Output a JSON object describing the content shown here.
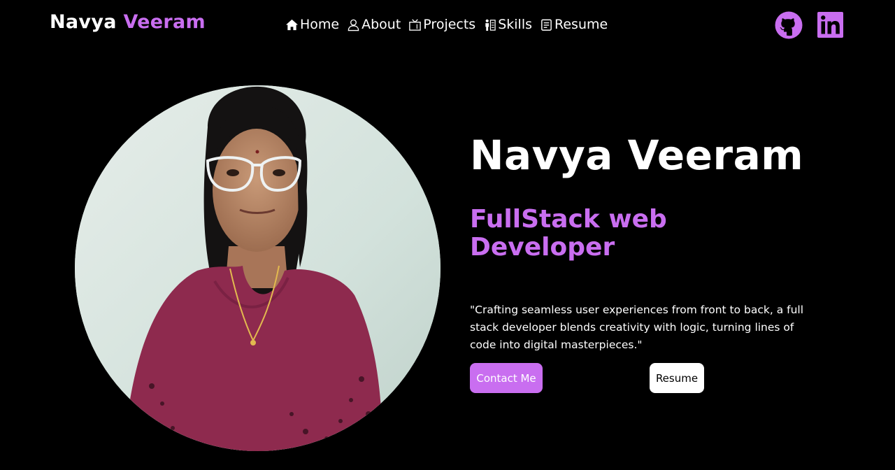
{
  "header": {
    "brand_first": "Navya",
    "brand_last": "Veeram",
    "nav": [
      {
        "label": "Home",
        "icon": "home-icon"
      },
      {
        "label": "About",
        "icon": "user-icon"
      },
      {
        "label": "Projects",
        "icon": "projects-icon"
      },
      {
        "label": "Skills",
        "icon": "skills-icon"
      },
      {
        "label": "Resume",
        "icon": "resume-icon"
      }
    ],
    "socials": [
      {
        "icon": "github-icon"
      },
      {
        "icon": "linkedin-icon"
      }
    ]
  },
  "hero": {
    "name": "Navya Veeram",
    "role": "FullStack web Developer",
    "quote": "\"Crafting seamless user experiences from front to back, a full stack developer blends creativity with logic, turning lines of code into digital masterpieces.\"",
    "contact_label": "Contact Me",
    "resume_label": "Resume"
  },
  "colors": {
    "background": "#000000",
    "accent": "#c96ef0",
    "text": "#ffffff"
  }
}
